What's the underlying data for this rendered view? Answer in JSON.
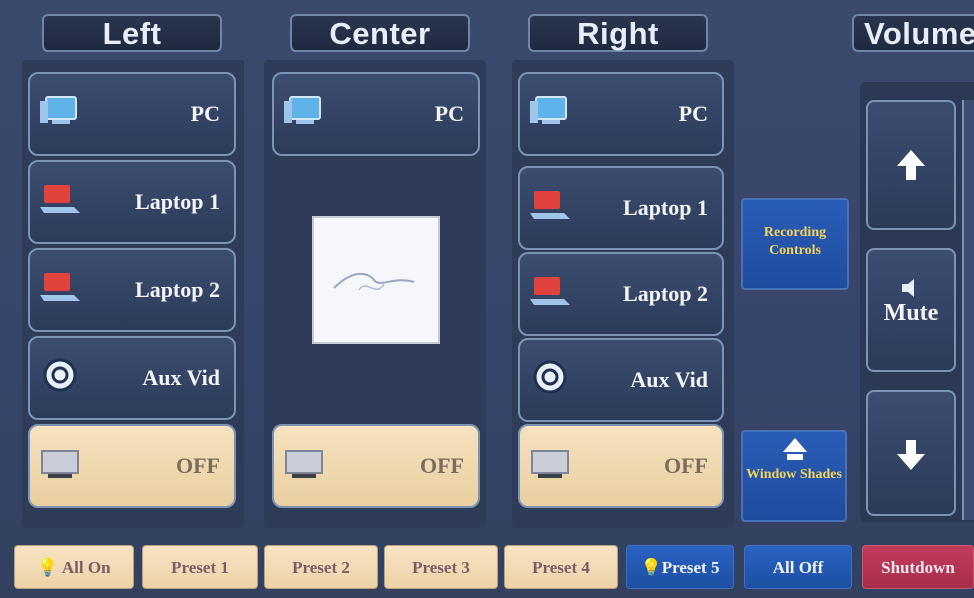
{
  "headers": {
    "left": "Left",
    "center": "Center",
    "right": "Right",
    "volume": "Volume"
  },
  "sources": {
    "pc": "PC",
    "laptop1": "Laptop 1",
    "laptop2": "Laptop 2",
    "aux": "Aux Vid",
    "off": "OFF"
  },
  "side": {
    "recording": "Recording Controls",
    "shades": "Window Shades"
  },
  "volume": {
    "mute": "Mute"
  },
  "bottom": [
    "All On",
    "Preset 1",
    "Preset 2",
    "Preset 3",
    "Preset 4",
    "Preset 5",
    "All Off",
    "Shutdown"
  ],
  "colors": {
    "accent_blue": "#2a5db8",
    "off_cream": "#f0d9b0",
    "shutdown_red": "#b8334f",
    "label_yellow": "#f5d35a"
  }
}
